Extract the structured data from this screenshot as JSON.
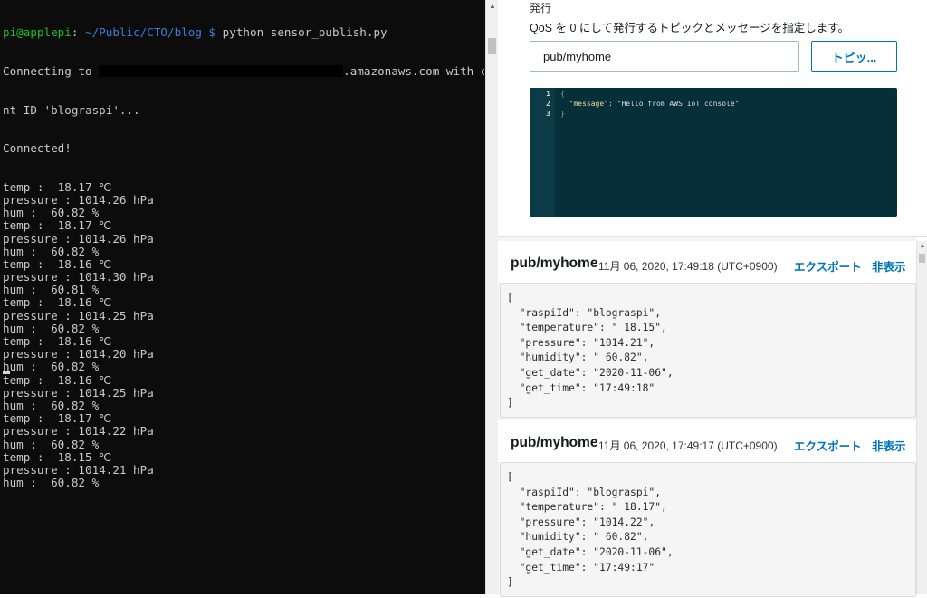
{
  "terminal": {
    "prompt_user": "pi@applepi",
    "prompt_path": "~/Public/CTO/blog $",
    "command": " python sensor_publish.py",
    "connecting_prefix": "Connecting to ",
    "connecting_suffix": ".amazonaws.com with clie",
    "client_id_line": "nt ID 'blograspi'...",
    "connected": "Connected!",
    "readings": [
      {
        "temp": "temp :  18.17 ℃",
        "pressure": "pressure : 1014.26 hPa",
        "hum": "hum :  60.82 %"
      },
      {
        "temp": "temp :  18.17 ℃",
        "pressure": "pressure : 1014.26 hPa",
        "hum": "hum :  60.82 %"
      },
      {
        "temp": "temp :  18.16 ℃",
        "pressure": "pressure : 1014.30 hPa",
        "hum": "hum :  60.81 %"
      },
      {
        "temp": "temp :  18.16 ℃",
        "pressure": "pressure : 1014.25 hPa",
        "hum": "hum :  60.82 %"
      },
      {
        "temp": "temp :  18.16 ℃",
        "pressure": "pressure : 1014.20 hPa",
        "hum": "hum :  60.82 %"
      },
      {
        "temp": "temp :  18.16 ℃",
        "pressure": "pressure : 1014.25 hPa",
        "hum": "hum :  60.82 %"
      },
      {
        "temp": "temp :  18.17 ℃",
        "pressure": "pressure : 1014.22 hPa",
        "hum": "hum :  60.82 %"
      },
      {
        "temp": "temp :  18.15 ℃",
        "pressure": "pressure : 1014.21 hPa",
        "hum": "hum :  60.82 %"
      }
    ]
  },
  "publish": {
    "title": "発行",
    "description": "QoS を 0 にして発行するトピックとメッセージを指定します。",
    "topic_value": "pub/myhome",
    "topic_button": "トピッ...",
    "editor": {
      "line_numbers": [
        "1",
        "2",
        "3"
      ],
      "line1": "{",
      "line2_key": "\"message\"",
      "line2_rest": ": \"Hello from AWS IoT console\"",
      "line3": "}"
    }
  },
  "messages": [
    {
      "topic": "pub/myhome",
      "time": "11月 06, 2020, 17:49:18 (UTC+0900)",
      "export_label": "エクスポート",
      "hide_label": "非表示",
      "payload": "[\n  \"raspiId\": \"blograspi\",\n  \"temperature\": \" 18.15\",\n  \"pressure\": \"1014.21\",\n  \"humidity\": \" 60.82\",\n  \"get_date\": \"2020-11-06\",\n  \"get_time\": \"17:49:18\"\n]"
    },
    {
      "topic": "pub/myhome",
      "time": "11月 06, 2020, 17:49:17 (UTC+0900)",
      "export_label": "エクスポート",
      "hide_label": "非表示",
      "payload": "[\n  \"raspiId\": \"blograspi\",\n  \"temperature\": \" 18.17\",\n  \"pressure\": \"1014.22\",\n  \"humidity\": \" 60.82\",\n  \"get_date\": \"2020-11-06\",\n  \"get_time\": \"17:49:17\"\n]"
    }
  ],
  "colors": {
    "terminal_bg": "#0c0c0c",
    "prompt_green": "#1ec01e",
    "prompt_blue": "#3b7dd8",
    "aws_link": "#0073bb",
    "editor_bg": "#062f3a"
  }
}
